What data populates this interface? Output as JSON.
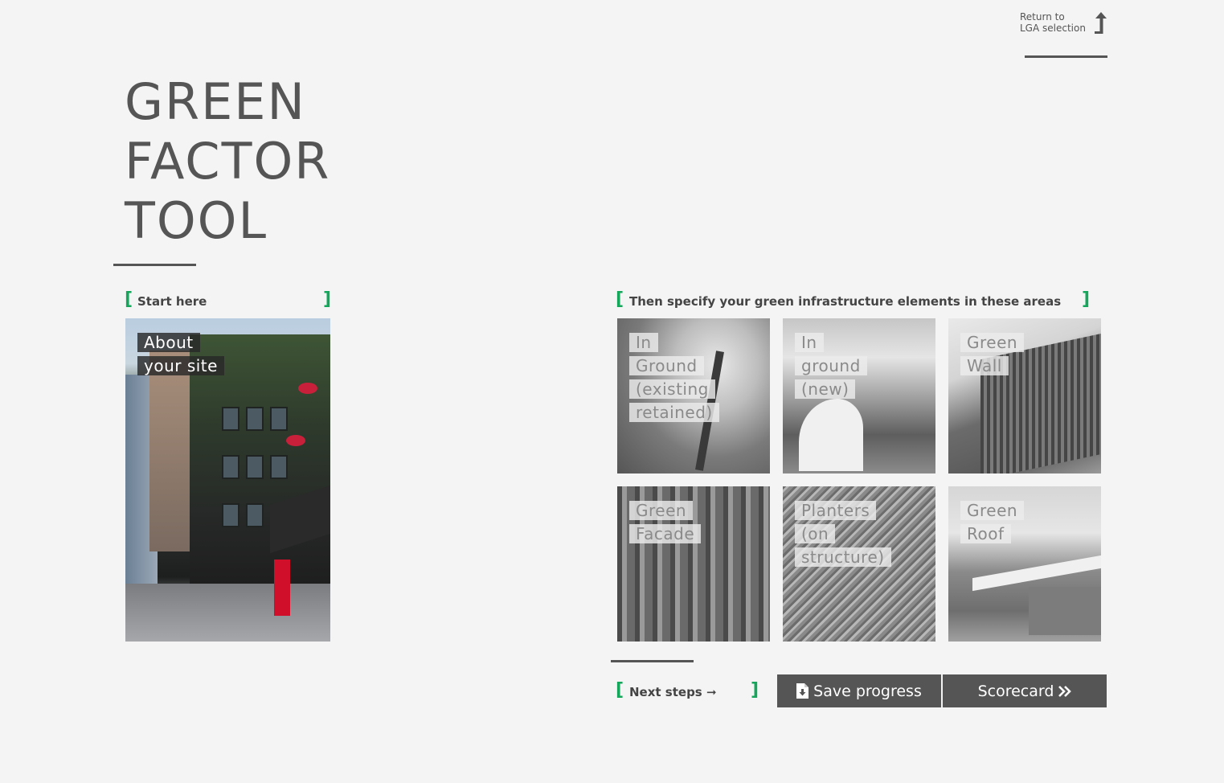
{
  "header": {
    "return_line1": "Return to",
    "return_line2": "LGA selection"
  },
  "title": {
    "line1": "GREEN",
    "line2": "FACTOR",
    "line3": "TOOL"
  },
  "start_section": {
    "label": "Start here",
    "card_line1": "About",
    "card_line2": "your site"
  },
  "areas_section": {
    "label": "Then specify your green infrastructure elements in these areas",
    "tiles": [
      {
        "lines": [
          "In",
          "Ground",
          "(existing",
          "retained)"
        ]
      },
      {
        "lines": [
          "In",
          "ground",
          "(new)"
        ]
      },
      {
        "lines": [
          "Green",
          "Wall"
        ]
      },
      {
        "lines": [
          "Green",
          "Facade"
        ]
      },
      {
        "lines": [
          "Planters",
          "(on",
          "structure)"
        ]
      },
      {
        "lines": [
          "Green",
          "Roof"
        ]
      }
    ]
  },
  "next_section": {
    "label": "Next steps",
    "arrow": "➞"
  },
  "buttons": {
    "save_label": "Save progress",
    "scorecard_label": "Scorecard",
    "save_icon": "file-download-icon",
    "scorecard_icon": "double-chevron-right-icon"
  },
  "colors": {
    "accent_bracket": "#14a65b",
    "text": "#555555",
    "background": "#f4f4f4",
    "button": "#555555"
  }
}
